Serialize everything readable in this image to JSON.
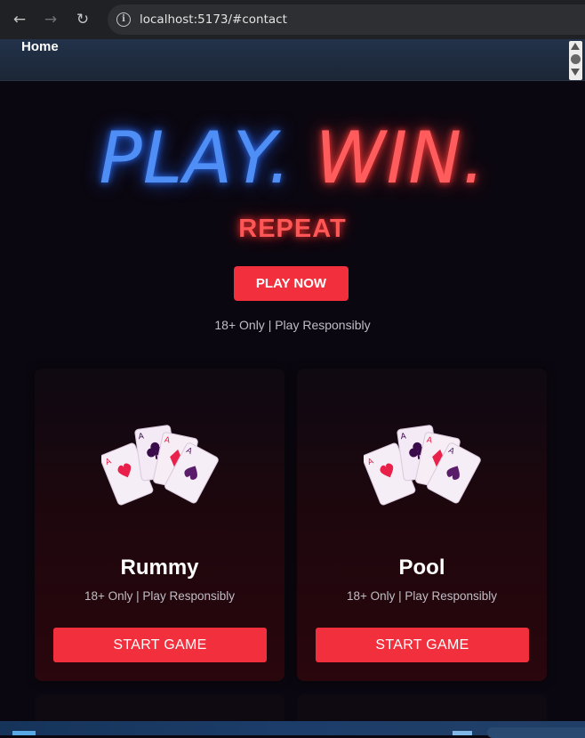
{
  "browser": {
    "url": "localhost:5173/#contact",
    "back_icon": "←",
    "forward_icon": "→",
    "reload_icon": "↻",
    "info_icon": "i"
  },
  "nav": {
    "home_label": "Home"
  },
  "hero": {
    "headline_play": "PLAY.",
    "headline_win": "WIN.",
    "subheadline": "REPEAT",
    "cta_label": "PLAY NOW",
    "note": "18+ Only | Play Responsibly"
  },
  "cards": [
    {
      "title": "Rummy",
      "note": "18+ Only | Play Responsibly",
      "button": "START GAME",
      "icon": "playing-cards-icon"
    },
    {
      "title": "Pool",
      "note": "18+ Only | Play Responsibly",
      "button": "START GAME",
      "icon": "playing-cards-icon"
    }
  ],
  "colors": {
    "accent_red": "#f22f3c",
    "neon_blue": "#4f8ff5",
    "neon_red": "#ff5d5d",
    "background": "#0b0710"
  }
}
